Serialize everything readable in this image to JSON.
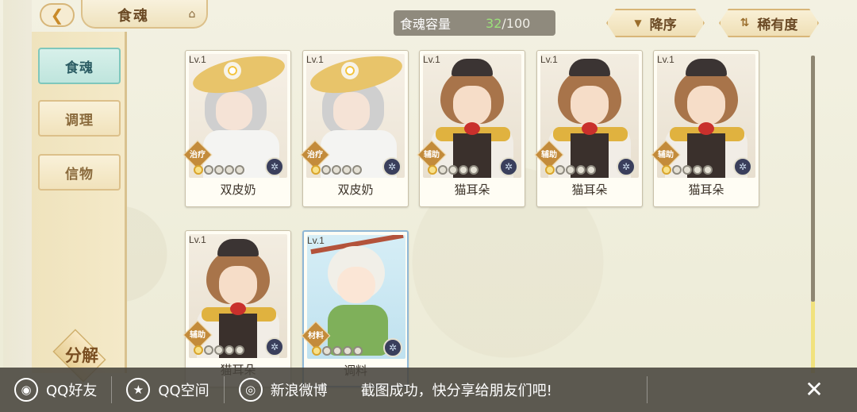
{
  "header": {
    "title": "食魂",
    "back_icon": "back-arrow-icon",
    "home_icon": "pavilion-icon",
    "capacity_label": "食魂容量",
    "capacity_count": "32",
    "capacity_max": "/100",
    "sort_label": "降序",
    "rarity_label": "稀有度"
  },
  "sidebar": {
    "items": [
      {
        "label": "食魂",
        "active": true
      },
      {
        "label": "调理",
        "active": false
      },
      {
        "label": "信物",
        "active": false
      }
    ],
    "decompose_label": "分解"
  },
  "cards": [
    {
      "level": "Lv.1",
      "name": "双皮奶",
      "role": "治疗",
      "art": "milk",
      "stars_on": 1
    },
    {
      "level": "Lv.1",
      "name": "双皮奶",
      "role": "治疗",
      "art": "milk",
      "stars_on": 1
    },
    {
      "level": "Lv.1",
      "name": "猫耳朵",
      "role": "辅助",
      "art": "cat",
      "stars_on": 1
    },
    {
      "level": "Lv.1",
      "name": "猫耳朵",
      "role": "辅助",
      "art": "cat",
      "stars_on": 1
    },
    {
      "level": "Lv.1",
      "name": "猫耳朵",
      "role": "辅助",
      "art": "cat",
      "stars_on": 1
    },
    {
      "level": "Lv.1",
      "name": "猫耳朵",
      "role": "辅助",
      "art": "cat",
      "stars_on": 1
    },
    {
      "level": "Lv.1",
      "name": "调料",
      "role": "材料",
      "art": "seasoning",
      "stars_on": 1
    }
  ],
  "sharebar": {
    "qq_friend": "QQ好友",
    "qq_zone": "QQ空间",
    "weibo": "新浪微博",
    "message": "截图成功，快分享给朋友们吧!",
    "close": "✕"
  },
  "colors": {
    "accent_teal": "#bfe5dd",
    "gold": "#d9a52d",
    "capacity_green": "#9be07a"
  }
}
